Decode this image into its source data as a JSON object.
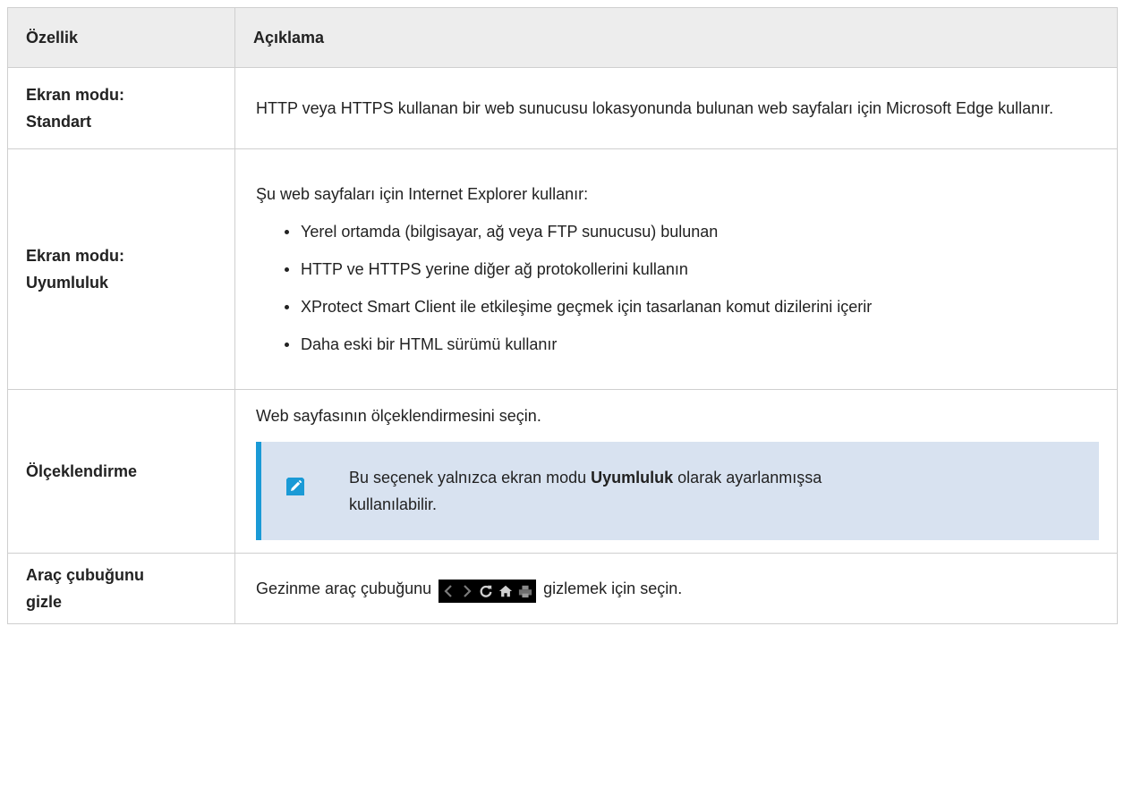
{
  "table": {
    "headers": {
      "property": "Özellik",
      "description": "Açıklama"
    },
    "rows": [
      {
        "name_line1": "Ekran modu:",
        "name_line2": "Standart",
        "description": "HTTP veya HTTPS kullanan bir web sunucusu lokasyonunda bulunan web sayfaları için Microsoft Edge kullanır."
      },
      {
        "name_line1": "Ekran modu:",
        "name_line2": "Uyumluluk",
        "intro": "Şu web sayfaları için Internet Explorer kullanır:",
        "bullets": [
          "Yerel ortamda (bilgisayar, ağ veya FTP sunucusu) bulunan",
          "HTTP ve HTTPS yerine diğer ağ protokollerini kullanın",
          "XProtect Smart Client ile etkileşime geçmek için tasarlanan komut dizilerini içerir",
          "Daha eski bir HTML sürümü kullanır"
        ]
      },
      {
        "name": "Ölçeklendirme",
        "description": "Web sayfasının ölçeklendirmesini seçin.",
        "note": {
          "icon": "pencil-note-icon",
          "text_before": "Bu seçenek yalnızca ekran modu ",
          "text_bold": "Uyumluluk",
          "text_after": " olarak ayarlanmışsa kullanılabilir."
        }
      },
      {
        "name_line1": "Araç çubuğunu",
        "name_line2": "gizle",
        "description_before": "Gezinme araç çubuğunu",
        "toolbar_icons": [
          "back-icon",
          "forward-icon",
          "refresh-icon",
          "home-icon",
          "print-icon"
        ],
        "description_after": "gizlemek için seçin."
      }
    ]
  },
  "colors": {
    "header_bg": "#ededed",
    "border": "#cfcfcf",
    "note_bg": "#d8e2f0",
    "note_accent": "#1a9ad6",
    "text": "#222222"
  }
}
